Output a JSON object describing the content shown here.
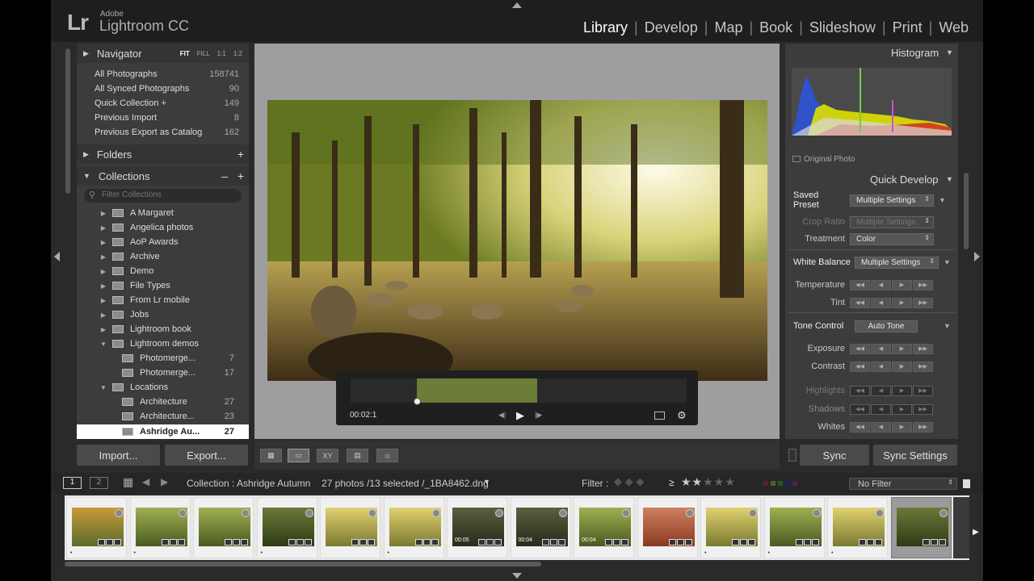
{
  "app": {
    "logo_mark": "Lr",
    "vendor": "Adobe",
    "product": "Lightroom CC"
  },
  "modules": [
    "Library",
    "Develop",
    "Map",
    "Book",
    "Slideshow",
    "Print",
    "Web"
  ],
  "active_module": "Library",
  "navigator": {
    "title": "Navigator",
    "options": [
      "FIT",
      "FILL",
      "1:1",
      "1:2"
    ],
    "selected_option": "FIT"
  },
  "catalog": [
    {
      "label": "All Photographs",
      "count": "158741"
    },
    {
      "label": "All Synced Photographs",
      "count": "90"
    },
    {
      "label": "Quick Collection  +",
      "count": "149"
    },
    {
      "label": "Previous Import",
      "count": "8"
    },
    {
      "label": "Previous Export as Catalog",
      "count": "162"
    }
  ],
  "folders": {
    "title": "Folders",
    "plus": "+"
  },
  "collections": {
    "title": "Collections",
    "minus": "–",
    "plus": "+",
    "filter_placeholder": "Filter Collections",
    "items": [
      {
        "label": "A Margaret",
        "count": ""
      },
      {
        "label": "Angelica photos",
        "count": ""
      },
      {
        "label": "AoP Awards",
        "count": ""
      },
      {
        "label": "Archive",
        "count": ""
      },
      {
        "label": "Demo",
        "count": ""
      },
      {
        "label": "File Types",
        "count": ""
      },
      {
        "label": "From Lr mobile",
        "count": ""
      },
      {
        "label": "Jobs",
        "count": ""
      },
      {
        "label": "Lightroom book",
        "count": ""
      },
      {
        "label": "Lightroom demos",
        "count": ""
      },
      {
        "label": "Photomerge...",
        "count": "7"
      },
      {
        "label": "Photomerge...",
        "count": "17"
      },
      {
        "label": "Locations",
        "count": ""
      },
      {
        "label": "Architecture",
        "count": "27"
      },
      {
        "label": "Architecture...",
        "count": "23"
      },
      {
        "label": "Ashridge Au...",
        "count": "27"
      }
    ]
  },
  "left_buttons": {
    "import": "Import...",
    "export": "Export..."
  },
  "video": {
    "timecode": "00:02:1"
  },
  "histogram": {
    "title": "Histogram",
    "original_photo": "Original Photo"
  },
  "quick_develop": {
    "title": "Quick Develop",
    "saved_preset_label": "Saved Preset",
    "saved_preset_value": "Multiple Settings",
    "crop_ratio_label": "Crop Ratio",
    "crop_ratio_value": "Multiple Settings",
    "treatment_label": "Treatment",
    "treatment_value": "Color",
    "white_balance_label": "White Balance",
    "white_balance_value": "Multiple Settings",
    "temperature_label": "Temperature",
    "tint_label": "Tint",
    "tone_control_label": "Tone Control",
    "auto_tone": "Auto Tone",
    "exposure_label": "Exposure",
    "contrast_label": "Contrast",
    "highlights_label": "Highlights",
    "shadows_label": "Shadows",
    "whites_label": "Whites"
  },
  "right_buttons": {
    "sync": "Sync",
    "sync_settings": "Sync Settings"
  },
  "bottom": {
    "screen1": "1",
    "screen2": "2",
    "source": "Collection : Ashridge Autumn",
    "selection": "27 photos /13 selected /_1BA8462.dng",
    "filter_label": "Filter :",
    "rating_op": "≥",
    "no_filter": "No Filter"
  },
  "filmstrip": [
    {
      "video": "",
      "star": "•",
      "tone": "autumn"
    },
    {
      "video": "",
      "star": "•",
      "tone": "green"
    },
    {
      "video": "",
      "star": "",
      "tone": "green"
    },
    {
      "video": "",
      "star": "•",
      "tone": "forest"
    },
    {
      "video": "",
      "star": "",
      "tone": "yellow"
    },
    {
      "video": "",
      "star": "•",
      "tone": "yellow"
    },
    {
      "video": "00:05",
      "star": "",
      "tone": "dark"
    },
    {
      "video": "00:04",
      "star": "",
      "tone": "dark"
    },
    {
      "video": "00:04",
      "star": "",
      "tone": "green"
    },
    {
      "video": "",
      "star": "",
      "tone": "red"
    },
    {
      "video": "",
      "star": "•",
      "tone": "yellow"
    },
    {
      "video": "",
      "star": "•",
      "tone": "green"
    },
    {
      "video": "",
      "star": "•",
      "tone": "yellow"
    },
    {
      "video": "",
      "star": "",
      "tone": "forest"
    }
  ]
}
